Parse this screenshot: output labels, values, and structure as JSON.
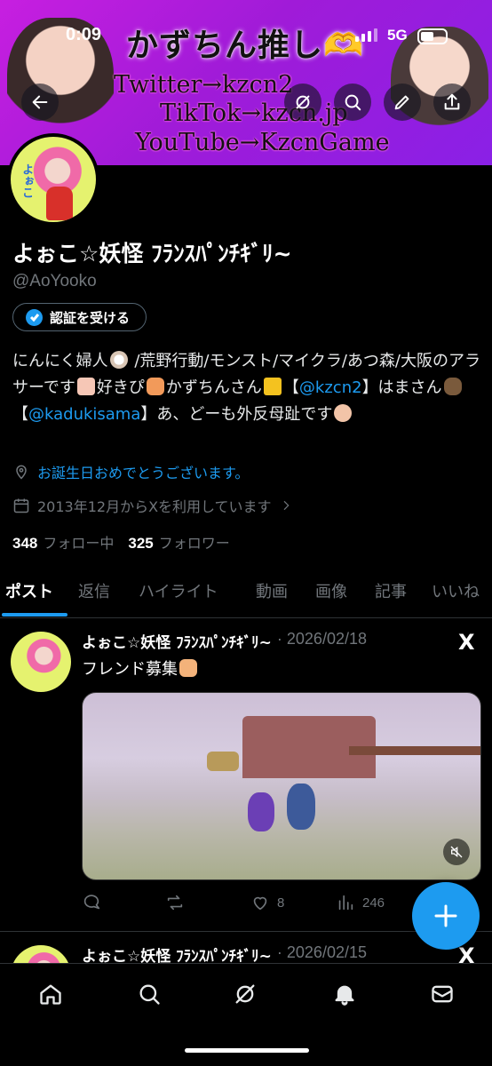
{
  "status_bar": {
    "time": "0:09",
    "network": "5G"
  },
  "banner": {
    "heading": "かずちん推し🫶",
    "lines": [
      "Twitter→kzcn2",
      "TikTok→kzcn.jp",
      "YouTube→KzcnGame"
    ]
  },
  "top_actions": [
    "back-arrow-icon",
    "grok-icon",
    "search-icon",
    "edit-icon",
    "share-icon"
  ],
  "profile": {
    "name": "よぉこ☆妖怪 ﾌﾗﾝｽﾊﾟﾝﾁｷﾞﾘ~",
    "handle": "@AoYooko",
    "verify_label": "認証を受ける",
    "bio": {
      "p1": "にんにく婦人",
      "p2": " /荒野行動/モンスト/マイクラ/あつ森/大阪のアラサーです",
      "p3": "好きぴ",
      "p4": "かずちんさん",
      "mention1": "@kzcn2",
      "p5": "】はまさん",
      "mention2": "@kadukisama",
      "p6": "】あ、どーも外反母趾です",
      "bracket_open": "【"
    },
    "birthday": "お誕生日おめでとうございます。",
    "joined": "2013年12月からXを利用しています",
    "following_count": "348",
    "following_label": "フォロー中",
    "followers_count": "325",
    "followers_label": "フォロワー"
  },
  "tabs": [
    "ポスト",
    "返信",
    "ハイライト",
    "動画",
    "画像",
    "記事",
    "いいね"
  ],
  "active_tab": "ポスト",
  "posts": [
    {
      "name": "よぉこ☆妖怪 ﾌﾗﾝｽﾊﾟﾝﾁｷﾞﾘ~",
      "date": "· 2026/02/18",
      "text": "フレンド募集",
      "replies": "",
      "reposts": "",
      "likes": "8",
      "views": "246"
    },
    {
      "name": "よぉこ☆妖怪 ﾌﾗﾝｽﾊﾟﾝﾁｷﾞﾘ~",
      "date": "· 2026/02/15"
    }
  ],
  "x_logo": "X",
  "colors": {
    "accent": "#1d9bf0",
    "background": "#000000",
    "muted": "#71767b",
    "banner": "#b01fe0"
  },
  "bottom_nav": [
    "home-icon",
    "search-icon",
    "grok-icon",
    "notifications-icon",
    "messages-icon"
  ]
}
